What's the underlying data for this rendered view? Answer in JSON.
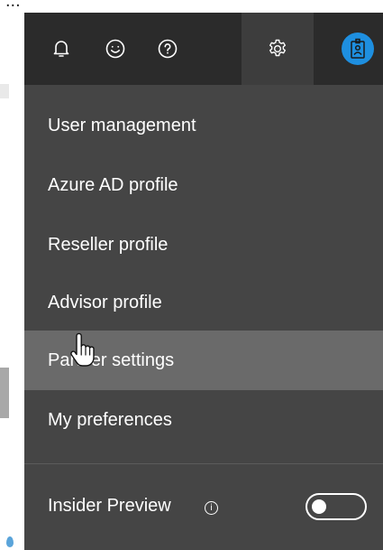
{
  "background_page": {
    "top_text": "..."
  },
  "header": {
    "icons": [
      {
        "name": "bell-icon"
      },
      {
        "name": "smiley-icon"
      },
      {
        "name": "help-icon"
      },
      {
        "name": "gear-icon",
        "active": true
      },
      {
        "name": "avatar-icon"
      }
    ]
  },
  "menu": {
    "items": [
      {
        "label": "User management"
      },
      {
        "label": "Azure AD profile"
      },
      {
        "label": "Reseller profile"
      },
      {
        "label": "Advisor profile"
      },
      {
        "label": "Partner settings",
        "hovered": true
      },
      {
        "label": "My preferences"
      }
    ],
    "insider_preview": {
      "label": "Insider Preview",
      "info_symbol": "i",
      "toggle_on": false
    }
  },
  "colors": {
    "header_bg": "#2b2b2b",
    "menu_bg": "#454545",
    "hover_bg": "#6a6a6a",
    "avatar_bg": "#1e8fe0"
  }
}
